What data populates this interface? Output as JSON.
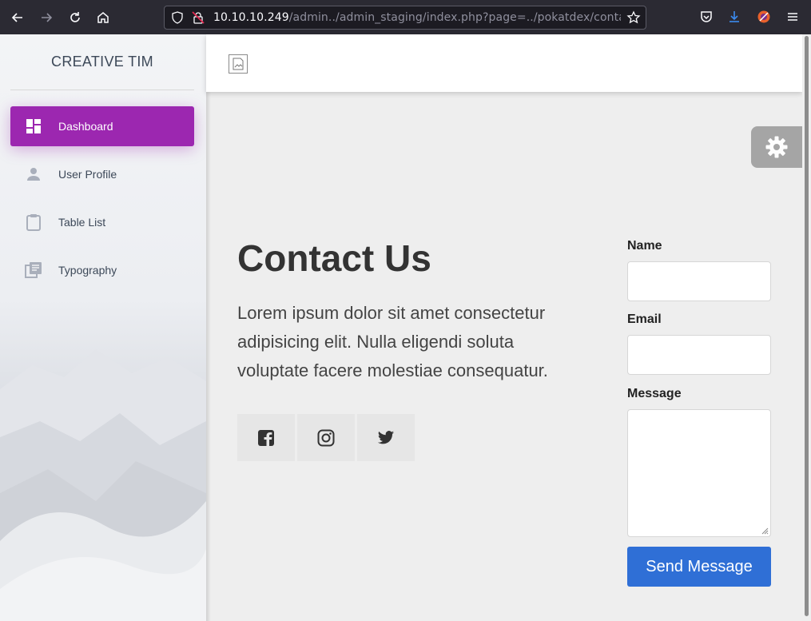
{
  "browser": {
    "url_host": "10.10.10.249",
    "url_path": "/admin../admin_staging/index.php?page=../pokatdex/contact"
  },
  "sidebar": {
    "brand": "CREATIVE TIM",
    "items": [
      {
        "label": "Dashboard",
        "icon": "dashboard-icon",
        "active": true
      },
      {
        "label": "User Profile",
        "icon": "person-icon",
        "active": false
      },
      {
        "label": "Table List",
        "icon": "clipboard-icon",
        "active": false
      },
      {
        "label": "Typography",
        "icon": "library-books-icon",
        "active": false
      }
    ]
  },
  "contact": {
    "title": "Contact Us",
    "text": "Lorem ipsum dolor sit amet consectetur adipisicing elit. Nulla eligendi soluta voluptate facere molestiae consequatur.",
    "social": [
      "facebook-icon",
      "instagram-icon",
      "twitter-icon"
    ]
  },
  "form": {
    "name_label": "Name",
    "email_label": "Email",
    "message_label": "Message",
    "name_value": "",
    "email_value": "",
    "message_value": "",
    "submit_label": "Send Message"
  },
  "colors": {
    "active_item": "#9c27b0",
    "button": "#2f6fd6",
    "page_bg": "#eeeeee"
  }
}
